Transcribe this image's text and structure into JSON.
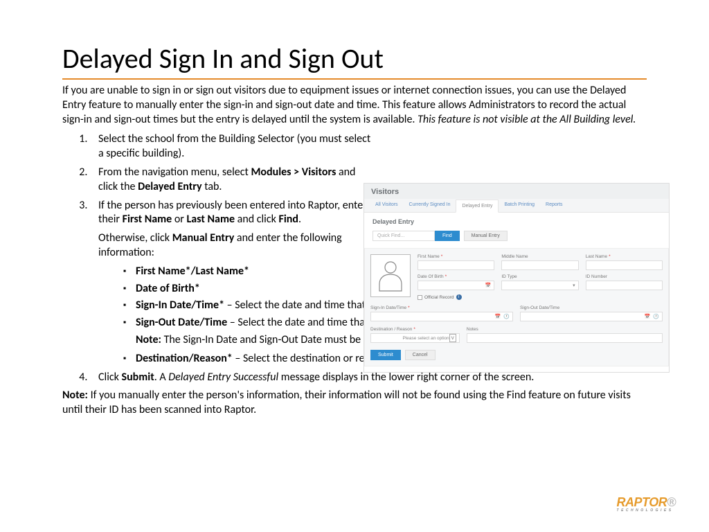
{
  "title": "Delayed Sign In and Sign Out",
  "intro": {
    "text": "If you are unable to sign in or sign out visitors due to equipment issues or internet connection issues, you can use the Delayed Entry feature to manually enter the sign-in and sign-out date and time. This feature allows Administrators to record the actual sign-in and sign-out times but the entry is delayed until the system is available. ",
    "italic": "This feature is not visible at the All Building level."
  },
  "steps": {
    "s1": "Select the school from the Building Selector (you must select a specific building).",
    "s2_a": "From the navigation menu, select ",
    "s2_b": "Modules > Visitors",
    "s2_c": " and click the ",
    "s2_d": "Delayed Entry",
    "s2_e": " tab.",
    "s3_a": "If the person has previously been entered into Raptor, enter their ",
    "s3_b": "First Name",
    "s3_c": " or ",
    "s3_d": "Last Name",
    "s3_e": " and click ",
    "s3_f": "Find",
    "s3_g": ".",
    "s3_sub_a": "Otherwise, click ",
    "s3_sub_b": "Manual Entry",
    "s3_sub_c": " and enter the following information:",
    "b1": "First Name*/Last Name*",
    "b2": "Date of Birth*",
    "b3_a": "Sign-In Date/Time*",
    "b3_b": " – Select the date and time that the person actually signed in.",
    "b4_a": "Sign-Out Date/Time",
    "b4_b": " – Select the date and time that the person actually signed out.",
    "note1_a": "Note:",
    "note1_b": " The Sign-In Date and Sign-Out Date must be the same date.",
    "b5_a": "Destination/Reason*",
    "b5_b": " – Select the destination or reason for visit.",
    "s4_a": "Click ",
    "s4_b": "Submit",
    "s4_c": ". A ",
    "s4_d": "Delayed Entry Successful",
    "s4_e": " message displays in the lower right corner of the screen."
  },
  "outro_a": "Note:",
  "outro_b": " If you manually enter the person's information, their information will not be found using the Find feature on future visits until their ID has been scanned into Raptor.",
  "shot": {
    "panel_title": "Visitors",
    "tabs": [
      "All Visitors",
      "Currently Signed In",
      "Delayed Entry",
      "Batch Printing",
      "Reports"
    ],
    "subtitle": "Delayed Entry",
    "quick_find_ph": "Quick Find...",
    "find_btn": "Find",
    "manual_btn": "Manual Entry",
    "labels": {
      "first": "First Name",
      "middle": "Middle Name",
      "last": "Last Name",
      "dob": "Date Of Birth",
      "idtype": "ID Type",
      "idnum": "ID Number",
      "official": "Official Record",
      "signin": "Sign-In Date/Time",
      "signout": "Sign-Out Date/Time",
      "dest": "Destination / Reason",
      "notes": "Notes",
      "dest_ph": "Please select an option"
    },
    "submit": "Submit",
    "cancel": "Cancel"
  },
  "logo": {
    "main": "RAPTOR",
    "sub": "TECHNOLOGIES"
  }
}
